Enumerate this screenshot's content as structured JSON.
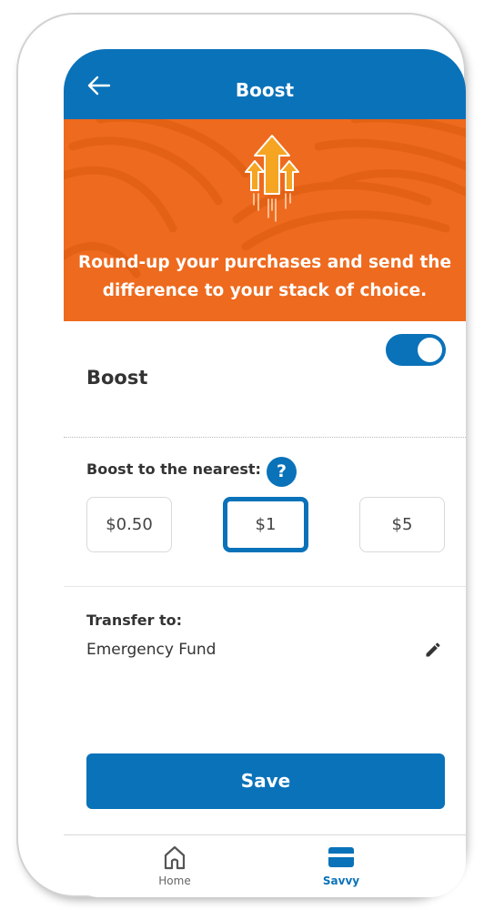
{
  "header": {
    "title": "Boost",
    "back_icon": "arrow-left-icon"
  },
  "banner": {
    "icon": "boost-arrows-icon",
    "text": "Round-up your purchases and send the difference to your stack of choice.",
    "background": "#EE6A1E"
  },
  "boost": {
    "title": "Boost",
    "enabled": true
  },
  "round_up": {
    "label": "Boost to the nearest:",
    "help_glyph": "?",
    "options": [
      {
        "label": "$0.50",
        "selected": false
      },
      {
        "label": "$1",
        "selected": true
      },
      {
        "label": "$5",
        "selected": false
      }
    ]
  },
  "transfer": {
    "label": "Transfer to:",
    "value": "Emergency Fund",
    "edit_icon": "pencil-icon"
  },
  "save": {
    "label": "Save"
  },
  "bottom_nav": {
    "items": [
      {
        "label": "Home",
        "icon": "home-icon",
        "active": false
      },
      {
        "label": "Savvy",
        "icon": "card-icon",
        "active": true
      }
    ]
  },
  "colors": {
    "primary": "#0A72B9",
    "accent": "#EE6A1E",
    "text": "#333333"
  }
}
